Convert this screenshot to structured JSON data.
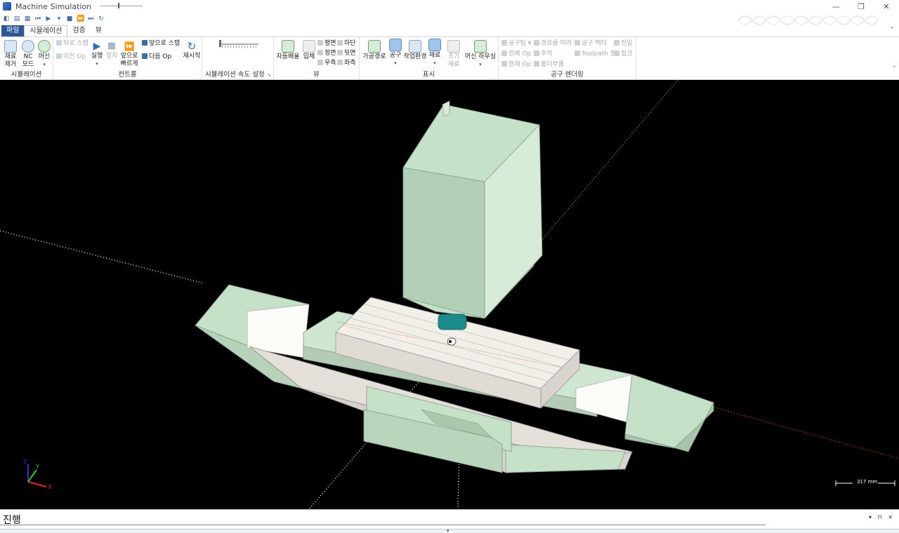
{
  "window": {
    "title": "Machine Simulation",
    "controls": {
      "minimize": "—",
      "restore": "❐",
      "close": "✕"
    }
  },
  "tabs": [
    {
      "label": "파일"
    },
    {
      "label": "시뮬레이션"
    },
    {
      "label": "검증"
    },
    {
      "label": "뷰"
    }
  ],
  "ribbon": {
    "simulation": {
      "label": "시뮬레이션",
      "remove_stock": "재료\n제거",
      "nc_mode": "NC\n모드",
      "machine": "머신"
    },
    "control": {
      "label": "컨트롤",
      "step_back": "뒤로 스텝",
      "prev_op": "이전 Op",
      "run": "실행",
      "stop": "정지",
      "fast_forward": "앞으로\n빠르게",
      "step_forward": "앞으로 스텝",
      "next_op": "다음 Op",
      "restart": "재시작"
    },
    "speed": {
      "label": "시뮬레이션 속도 설정"
    },
    "view": {
      "label": "뷰",
      "auto_fit": "자동배율",
      "iso": "입체",
      "top": "평면",
      "front": "정면",
      "right": "우측",
      "bottom": "하단",
      "back": "뒷면",
      "left": "좌측"
    },
    "display": {
      "label": "표시",
      "toolpath": "가공경로",
      "tool": "공구",
      "workholding": "작업환경",
      "stock": "재료",
      "initial_stock": "초기\n재료",
      "machine_housing": "머신 하우싱"
    },
    "tool_render": {
      "label": "공구 렌더링",
      "tool_tip": "공구팁",
      "along_path": "경로를 따라",
      "tool_vector": "공구 벡터",
      "entry": "진입",
      "all_op": "전체 Op",
      "trace": "추적",
      "toolpath_point": "Toolpath 점",
      "link": "링크",
      "current_op": "현재 Op",
      "holder_part": "홀더부품"
    }
  },
  "viewport": {
    "scale": "317 mm",
    "axes": {
      "x": "X",
      "y": "Y",
      "z": "Z"
    },
    "colors": {
      "background": "#000000",
      "machine_green": "#c5e2c8",
      "machine_gray": "#e4e0d9",
      "tool": "#1a8a8a"
    }
  },
  "progress": {
    "label": "진행",
    "controls": "▾ ⊓ ✕"
  }
}
